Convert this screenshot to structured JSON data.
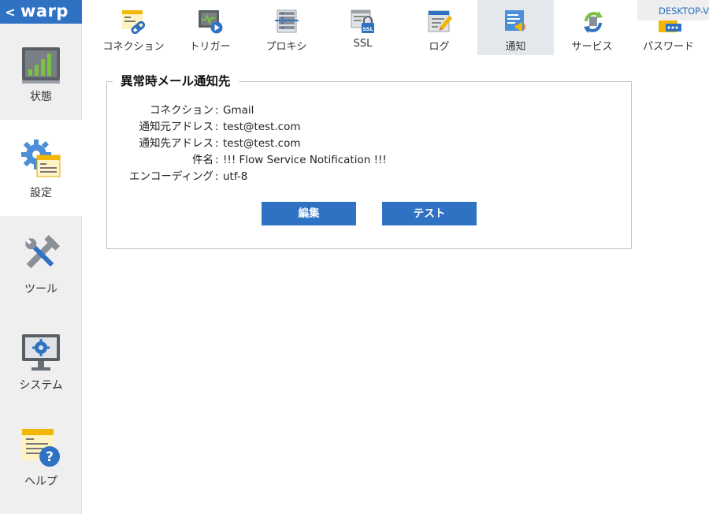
{
  "app": {
    "brand": "warp",
    "back_glyph": "<"
  },
  "host_label": "DESKTOP-V",
  "sidebar": {
    "items": [
      {
        "label": "状態",
        "icon": "status-chart-icon"
      },
      {
        "label": "設定",
        "icon": "settings-gear-icon",
        "active": true
      },
      {
        "label": "ツール",
        "icon": "tools-icon"
      },
      {
        "label": "システム",
        "icon": "system-monitor-icon"
      },
      {
        "label": "ヘルプ",
        "icon": "help-icon"
      }
    ]
  },
  "tabs": [
    {
      "label": "コネクション",
      "icon": "connection-icon"
    },
    {
      "label": "トリガー",
      "icon": "trigger-icon"
    },
    {
      "label": "プロキシ",
      "icon": "proxy-icon"
    },
    {
      "label": "SSL",
      "icon": "ssl-icon"
    },
    {
      "label": "ログ",
      "icon": "log-icon"
    },
    {
      "label": "通知",
      "icon": "notification-icon",
      "active": true
    },
    {
      "label": "サービス",
      "icon": "service-icon"
    },
    {
      "label": "パスワード",
      "icon": "password-icon"
    }
  ],
  "panel": {
    "title": "異常時メール通知先",
    "separator": ":",
    "fields": [
      {
        "key": "コネクション",
        "value": "Gmail"
      },
      {
        "key": "通知元アドレス",
        "value": "test@test.com"
      },
      {
        "key": "通知先アドレス",
        "value": "test@test.com"
      },
      {
        "key": "件名",
        "value": "!!! Flow Service Notification !!!"
      },
      {
        "key": "エンコーディング",
        "value": "utf-8"
      }
    ],
    "edit_label": "編集",
    "test_label": "テスト"
  },
  "colors": {
    "accent": "#2f72c4",
    "sidebar_bg": "#efefef",
    "active_tab_bg": "#e4e7ec"
  }
}
